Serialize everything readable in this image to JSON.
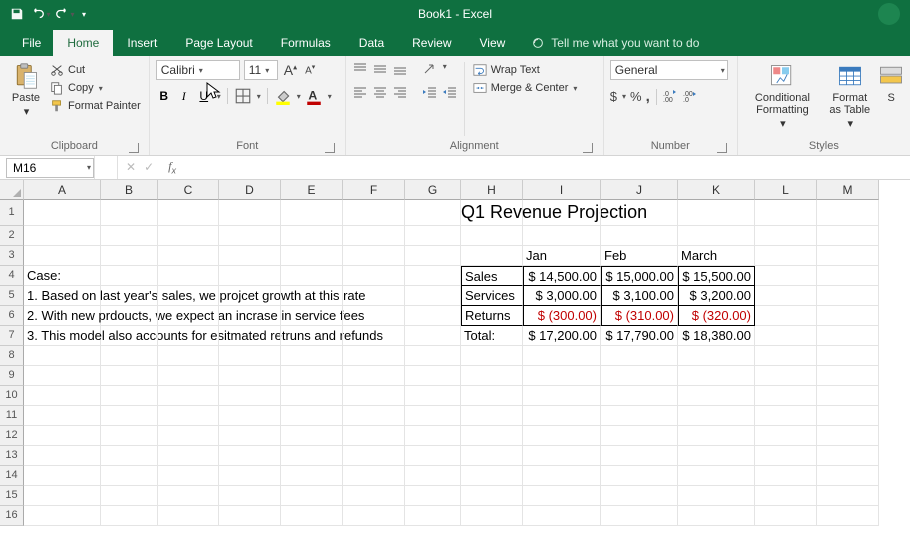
{
  "app": {
    "title": "Book1 - Excel"
  },
  "tabs": {
    "file": "File",
    "home": "Home",
    "insert": "Insert",
    "pageLayout": "Page Layout",
    "formulas": "Formulas",
    "data": "Data",
    "review": "Review",
    "view": "View",
    "tellme": "Tell me what you want to do"
  },
  "ribbon": {
    "clipboard": {
      "label": "Clipboard",
      "paste": "Paste",
      "cut": "Cut",
      "copy": "Copy",
      "formatPainter": "Format Painter"
    },
    "font": {
      "label": "Font",
      "name": "Calibri",
      "size": "11"
    },
    "alignment": {
      "label": "Alignment",
      "wrap": "Wrap Text",
      "merge": "Merge & Center"
    },
    "number": {
      "label": "Number",
      "format": "General"
    },
    "styles": {
      "label": "Styles",
      "cond": "Conditional Formatting",
      "table": "Format as Table",
      "cell": "S"
    }
  },
  "fxbar": {
    "namebox": "M16",
    "formula": ""
  },
  "columns": [
    "A",
    "B",
    "C",
    "D",
    "E",
    "F",
    "G",
    "H",
    "I",
    "J",
    "K",
    "L",
    "M"
  ],
  "rows": [
    "1",
    "2",
    "3",
    "4",
    "5",
    "6",
    "7",
    "8",
    "9",
    "10",
    "11",
    "12",
    "13",
    "14",
    "15",
    "16"
  ],
  "content": {
    "title": "Q1 Revenue Projection",
    "months": {
      "jan": "Jan",
      "feb": "Feb",
      "mar": "March"
    },
    "caseLabel": "Case:",
    "case1": "1. Based on last year's sales, we projcet growth at this rate",
    "case2": "2. With new prdoucts, we expect an incrase in service fees",
    "case3": "3. This model also accounts for esitmated retruns and refunds",
    "rowsLbl": {
      "sales": "Sales",
      "services": "Services",
      "returns": "Returns",
      "total": "Total:"
    },
    "vals": {
      "salesJan": "$ 14,500.00",
      "salesFeb": "$ 15,000.00",
      "salesMar": "$ 15,500.00",
      "servJan": "$   3,000.00",
      "servFeb": "$   3,100.00",
      "servMar": "$   3,200.00",
      "retJan": "$     (300.00)",
      "retFeb": "$     (310.00)",
      "retMar": "$     (320.00)",
      "totJan": "$ 17,200.00",
      "totFeb": "$ 17,790.00",
      "totMar": "$ 18,380.00"
    }
  },
  "chart_data": {
    "type": "table",
    "title": "Q1 Revenue Projection",
    "categories": [
      "Jan",
      "Feb",
      "March"
    ],
    "series": [
      {
        "name": "Sales",
        "values": [
          14500.0,
          15000.0,
          15500.0
        ]
      },
      {
        "name": "Services",
        "values": [
          3000.0,
          3100.0,
          3200.0
        ]
      },
      {
        "name": "Returns",
        "values": [
          -300.0,
          -310.0,
          -320.0
        ]
      },
      {
        "name": "Total",
        "values": [
          17200.0,
          17790.0,
          18380.0
        ]
      }
    ]
  }
}
